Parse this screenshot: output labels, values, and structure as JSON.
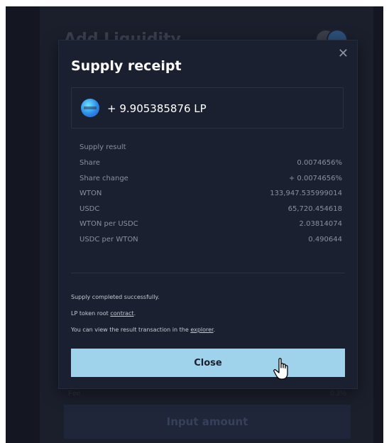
{
  "background": {
    "title": "Add Liquidity",
    "bottom_left": "Fee",
    "bottom_right": "0.3%",
    "input_button": "Input amount"
  },
  "modal": {
    "title": "Supply receipt",
    "close_icon": "close-icon",
    "lp_amount": "+ 9.905385876 LP",
    "token_icon": "lp-token-icon",
    "result_title": "Supply result",
    "rows": [
      {
        "label": "Share",
        "value": "0.0074656%"
      },
      {
        "label": "Share change",
        "value": "+ 0.0074656%"
      },
      {
        "label": "WTON",
        "value": "133,947.535999014"
      },
      {
        "label": "USDC",
        "value": "65,720.454618"
      },
      {
        "label": "WTON per USDC",
        "value": "2.03814074"
      },
      {
        "label": "USDC per WTON",
        "value": "0.490644"
      }
    ],
    "notes": {
      "completed": "Supply completed successfully.",
      "lp_prefix": "LP token root ",
      "lp_link": "contract",
      "lp_suffix": ".",
      "view_prefix": "You can view the result transaction in the ",
      "view_link": "explorer",
      "view_suffix": "."
    },
    "close_button": "Close"
  },
  "colors": {
    "background": "#141722",
    "modal": "#1b2030",
    "accent_button": "#9fd3ec"
  }
}
